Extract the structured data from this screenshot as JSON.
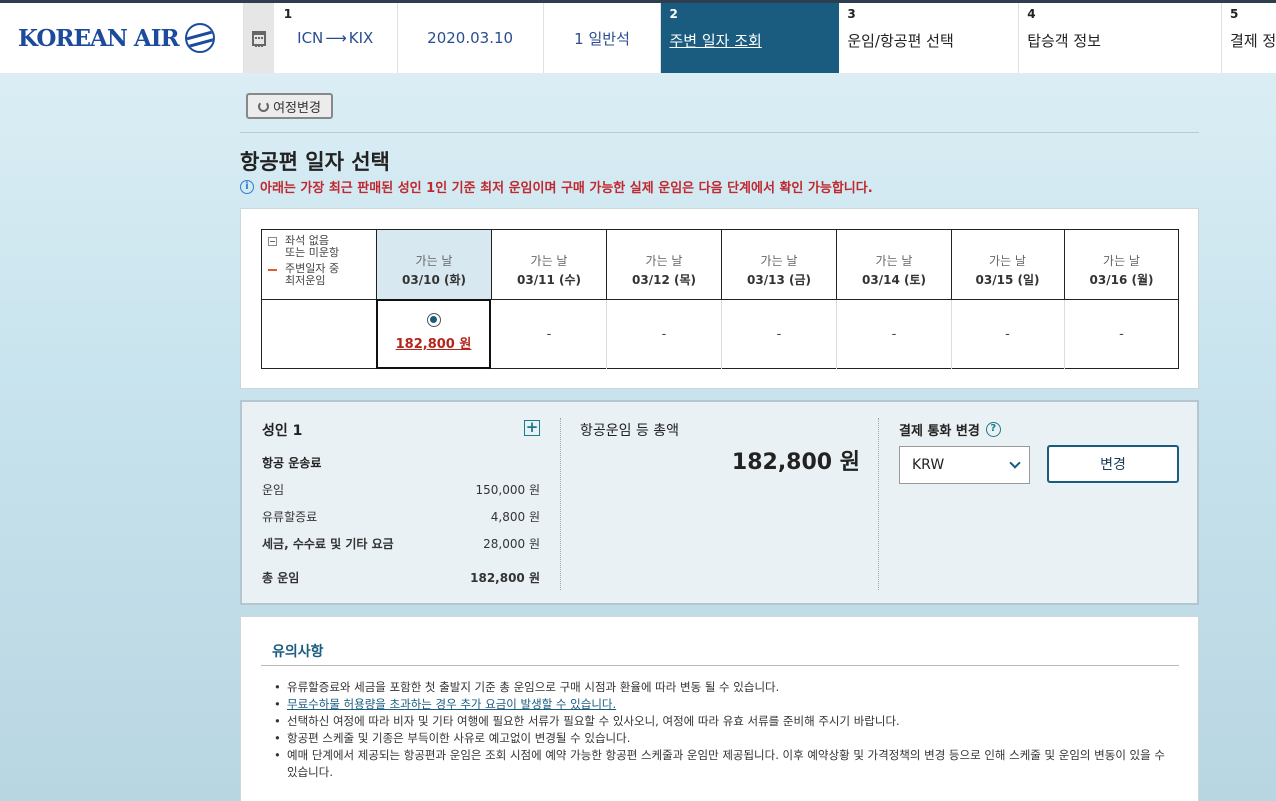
{
  "header": {
    "brand": "KOREAN AIR",
    "route_from": "ICN",
    "route_to": "KIX",
    "route_arrow": "⟶",
    "date": "2020.03.10",
    "cabin": "1 일반석",
    "steps": [
      {
        "num": "2",
        "label": "주변 일자 조회",
        "active": true
      },
      {
        "num": "3",
        "label": "운임/항공편 선택"
      },
      {
        "num": "4",
        "label": "탑승객 정보"
      },
      {
        "num": "5",
        "label": "결제 정보"
      }
    ],
    "step1_num": "1"
  },
  "change_itinerary": "여정변경",
  "page_title": "항공편 일자 선택",
  "notice": "아래는 가장 최근 판매된 성인 1인 기준 최저 운임이며 구매 가능한 실제 운임은 다음 단계에서 확인 가능합니다.",
  "legend": {
    "no_seat": [
      "좌석 없음",
      "또는 미운항"
    ],
    "lowest": [
      "주변일자 중",
      "최저운임"
    ]
  },
  "dates": [
    {
      "label": "가는 날",
      "date": "03/10 (화)",
      "price": "182,800 원",
      "selected": true
    },
    {
      "label": "가는 날",
      "date": "03/11 (수)",
      "price": "-"
    },
    {
      "label": "가는 날",
      "date": "03/12 (목)",
      "price": "-"
    },
    {
      "label": "가는 날",
      "date": "03/13 (금)",
      "price": "-"
    },
    {
      "label": "가는 날",
      "date": "03/14 (토)",
      "price": "-"
    },
    {
      "label": "가는 날",
      "date": "03/15 (일)",
      "price": "-"
    },
    {
      "label": "가는 날",
      "date": "03/16 (월)",
      "price": "-"
    }
  ],
  "summary": {
    "pax": "성인 1",
    "transport_fee": "항공 운송료",
    "fare_label": "운임",
    "fare_value": "150,000 원",
    "fuel_label": "유류할증료",
    "fuel_value": "4,800 원",
    "tax_label": "세금, 수수료 및 기타 요금",
    "tax_value": "28,000 원",
    "total_label": "총 운임",
    "total_value": "182,800 원",
    "grand_label": "항공운임 등 총액",
    "grand_value": "182,800 원",
    "currency_label": "결제 통화 변경",
    "currency_value": "KRW",
    "apply_button": "변경"
  },
  "notes": {
    "title": "유의사항",
    "items": [
      "유류할증료와 세금을 포함한 첫 출발지 기준 총 운임으로 구매 시점과 환율에 따라 변동 될 수 있습니다.",
      "무료수하물 허용량을 초과하는 경우 추가 요금이 발생할 수 있습니다.",
      "선택하신 여정에 따라 비자 및 기타 여행에 필요한 서류가 필요할 수 있사오니, 여정에 따라 유효 서류를 준비해 주시기 바랍니다.",
      "항공편 스케줄 및 기종은 부득이한 사유로 예고없이 변경될 수 있습니다.",
      "예매 단계에서 제공되는 항공편과 운임은 조회 시점에 예약 가능한 항공편 스케줄과 운임만 제공됩니다. 이후 예약상황 및 가격정책의 변경 등으로 인해 스케줄 및 운임의 변동이 있을 수 있습니다."
    ]
  },
  "colors": {
    "accent": "#1a5c80",
    "price": "#b4261b",
    "notice": "#c0282f"
  }
}
